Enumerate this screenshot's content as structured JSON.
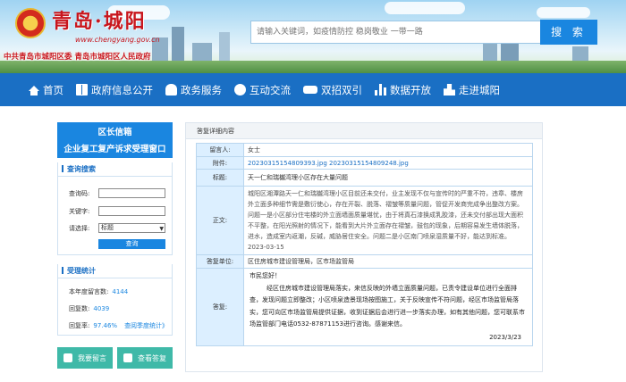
{
  "header": {
    "site_title": "青岛·城阳",
    "site_url": "www.chengyang.gov.cn",
    "sub_title": "中共青岛市城阳区委 青岛市城阳区人民政府",
    "search_placeholder": "请输入关键词，如疫情防控 稳岗敬业 一带一路",
    "search_button": "搜 索"
  },
  "nav": [
    {
      "label": "首页",
      "icon": "home-icon"
    },
    {
      "label": "政府信息公开",
      "icon": "book-icon"
    },
    {
      "label": "政务服务",
      "icon": "hand-icon"
    },
    {
      "label": "互动交流",
      "icon": "chat-icon"
    },
    {
      "label": "双招双引",
      "icon": "handshake-icon"
    },
    {
      "label": "数据开放",
      "icon": "bar-chart-icon"
    },
    {
      "label": "走进城阳",
      "icon": "city-icon"
    }
  ],
  "sidebar": {
    "title1": "区长信箱",
    "title2": "企业复工复产诉求受理窗口",
    "search_panel": {
      "title": "查询搜索",
      "code_label": "查询码:",
      "keyword_label": "关键字:",
      "select_label": "请选择:",
      "select_value": "标题",
      "query_button": "查询"
    },
    "stats_panel": {
      "title": "受理统计",
      "received_label": "本年度留言数:",
      "received_value": "4144",
      "replied_label": "回复数:",
      "replied_value": "4039",
      "rate_label": "回复率:",
      "rate_value": "97.46%",
      "quarter_link": "查阅季度统计》"
    },
    "leave_message_button": "我要留言",
    "view_reply_button": "查看答复"
  },
  "content": {
    "tab": "答复详细内容",
    "rows": {
      "author_label": "留言人:",
      "author_value": "女士",
      "attach_label": "附件:",
      "attach_files": [
        "20230315154809393.jpg",
        "20230315154809248.jpg"
      ],
      "title_label": "标题:",
      "title_value": "天一仁和瑞樾湾理小区存在大量问题",
      "body_label": "正文:",
      "body_value": "城阳区湘潭路天一仁和瑞樾湾理小区目前还未交付，业主发现不仅与宣传时的严重不符，违章、楼房外立面多种细节需是敷衍使心，存在开裂、脱落、褶皱等质量问题，管促开发商完成争出整改方案。问题一是小区部分住宅楼的外立面墙面质量堪忧，由于将真石漆换成乳胶漆，还未交付部出现大面积不平整，在阳光照射的情况下，能看到大片外立面存在褶皱，鼓包的现象，后期容易发生墙体脱落，进水，造成室内返潮，反碱，威胁居住安全。问题二是小区南门喷泉湿质量不好，能达到标准。2023-03-15",
      "dept_label": "答复单位:",
      "dept_value": "区住房城市建设管理局，区市场监管局",
      "reply_label": "答复:",
      "reply_greeting": "市民您好！",
      "reply_body": "经区住房城市建设管理局落实，来信反映的外墙立面质量问题，已责令建设单位进行全面排查，发现问题立即整改；小区喷泉造景现场按图施工，关于反映宣传不符问题，经区市场监管局落实，您可向区市场监管局提供证据，收到证据后会进行进一步落实办理，如有其他问题，您可联系市场监管部门电话0532-87871153进行咨询。感谢来信。",
      "reply_date": "2023/3/23"
    }
  },
  "colors": {
    "brand_red": "#c8161d",
    "nav_blue": "#1a6fc4",
    "accent_blue": "#1a86e0",
    "green_button": "#3fb9a8"
  }
}
